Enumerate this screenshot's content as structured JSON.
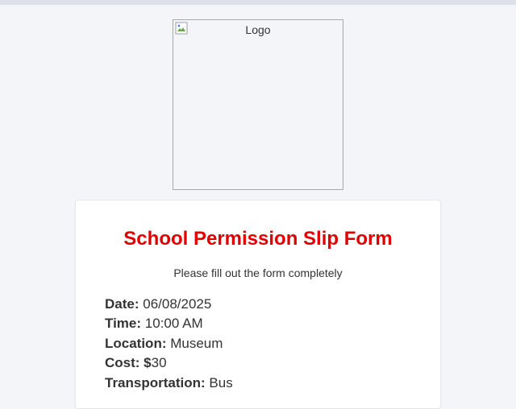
{
  "logo": {
    "alt_text": "Logo"
  },
  "form": {
    "title": "School Permission Slip Form",
    "title_color": "#e00000",
    "subtitle": "Please fill out the form completely",
    "details": [
      {
        "label": "Date:",
        "value": "06/08/2025"
      },
      {
        "label": "Time:",
        "value": "10:00 AM"
      },
      {
        "label": "Location:",
        "value": "Museum"
      },
      {
        "label": "Cost: $",
        "value": "30"
      },
      {
        "label": "Transportation:",
        "value": "Bus"
      }
    ]
  }
}
